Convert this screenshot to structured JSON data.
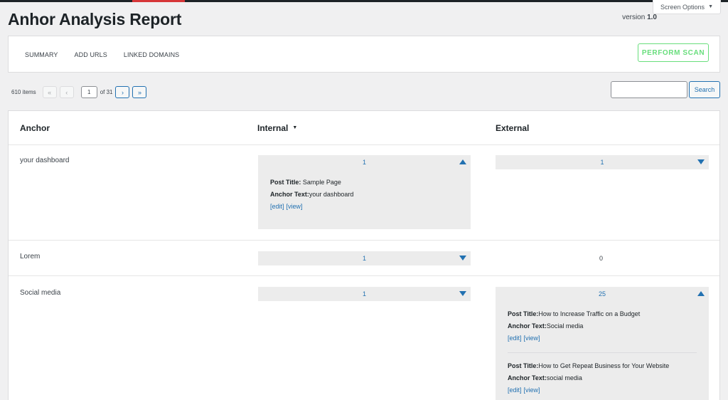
{
  "header": {
    "title": "Anhor Analysis Report",
    "version_label": "version",
    "version_number": "1.0",
    "screen_options": "Screen Options"
  },
  "nav": {
    "tabs": [
      {
        "label": "SUMMARY"
      },
      {
        "label": "ADD URLS"
      },
      {
        "label": "LINKED DOMAINS"
      }
    ],
    "scan_button": "PERFORM SCAN"
  },
  "pagination": {
    "items_count": "610 items",
    "first": "«",
    "prev": "‹",
    "current_page": "1",
    "of_label": "of 31",
    "next": "›",
    "last": "»"
  },
  "search": {
    "placeholder": "",
    "button_label": "Search"
  },
  "table": {
    "columns": {
      "anchor": "Anchor",
      "internal": "Internal",
      "external": "External"
    },
    "rows": [
      {
        "anchor": "your dashboard",
        "internal": {
          "count": "1",
          "expanded": true,
          "entries": [
            {
              "title_label": "Post Title:",
              "title": " Sample Page",
              "anchor_label": "Anchor Text:",
              "anchor": "your dashboard",
              "edit": "[edit]",
              "view": "[view]"
            }
          ]
        },
        "external": {
          "count": "1",
          "expanded": false
        }
      },
      {
        "anchor": "Lorem",
        "internal": {
          "count": "1",
          "expanded": false
        },
        "external": {
          "count": "0"
        }
      },
      {
        "anchor": "Social media",
        "internal": {
          "count": "1",
          "expanded": false
        },
        "external": {
          "count": "25",
          "expanded": true,
          "entries": [
            {
              "title_label": "Post Title:",
              "title": "How to Increase Traffic on a Budget",
              "anchor_label": "Anchor Text:",
              "anchor": "Social media",
              "edit": "[edit]",
              "view": "[view]"
            },
            {
              "title_label": "Post Title:",
              "title": "How to Get Repeat Business for Your Website",
              "anchor_label": "Anchor Text:",
              "anchor": "social media",
              "edit": "[edit]",
              "view": "[view]"
            }
          ]
        }
      }
    ]
  },
  "colors": {
    "accent_blue": "#2271b1",
    "scan_green": "#68de7c",
    "admin_bar": "#1d2327",
    "admin_bar_accent": "#d63638"
  },
  "icons": {
    "expand": "triangle-up-icon",
    "collapse": "triangle-down-icon",
    "sort": "sort-caret-icon",
    "dropdown": "caret-down-icon"
  }
}
